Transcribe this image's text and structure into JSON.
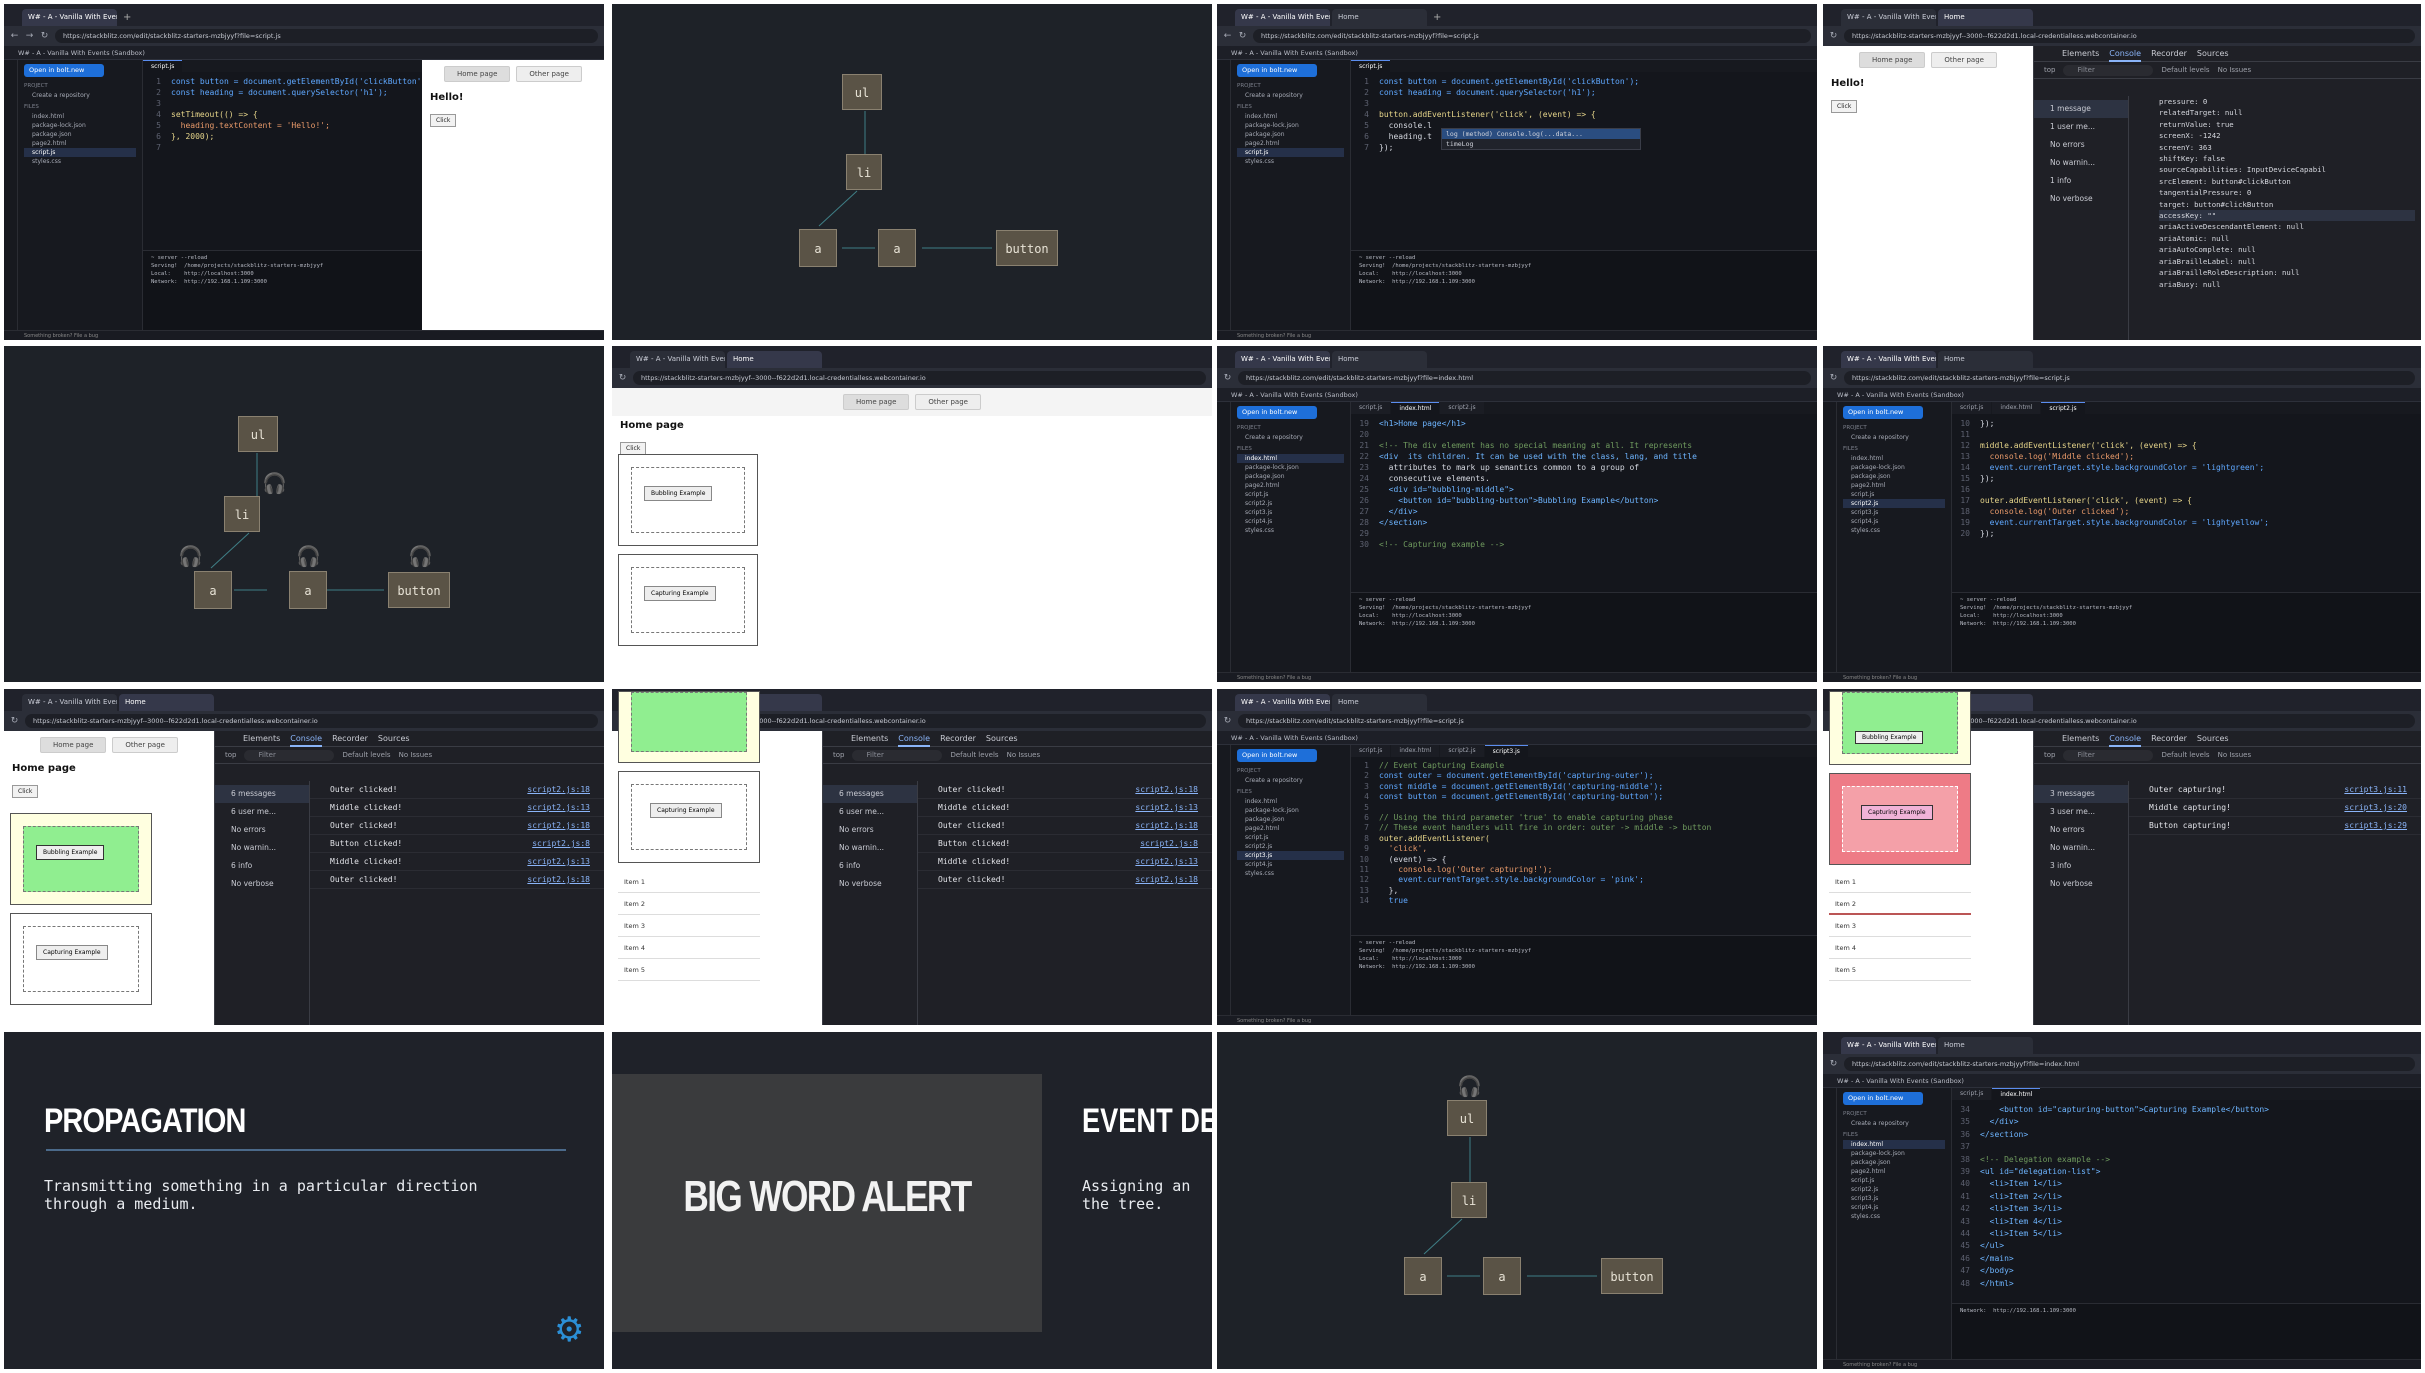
{
  "browser": {
    "tab_main": "W# - A - Vanilla With Events (...",
    "tab_home": "Home",
    "url_code": "https://stackblitz.com/edit/stackblitz-starters-mzbjyyf?file=script.js",
    "url_preview": "https://stackblitz-starters-mzbjyyf--3000--f622d2d1.local-credentialless.webcontainer.io",
    "url_index": "https://stackblitz.com/edit/stackblitz-starters-mzbjyyf?file=index.html",
    "bolt_title": "W# - A - Vanilla With Events (Sandbox)"
  },
  "ide": {
    "open_in": "Open in bolt.new",
    "project": "PROJECT",
    "create_repo": "Create a repository",
    "files_header": "FILES",
    "files": [
      "index.html",
      "package-lock.json",
      "package.json",
      "page2.html",
      "script.js",
      "styles.css"
    ],
    "files_ext": [
      "index.html",
      "package-lock.json",
      "package.json",
      "page2.html",
      "script.js",
      "script2.js",
      "script3.js",
      "script4.js",
      "styles.css"
    ],
    "terminal_lines": [
      "~ server --reload",
      "",
      "Serving!  /home/projects/stackblitz-starters-mzbjyyf",
      "",
      "Local:    http://localhost:3000",
      "Network:  http://192.168.1.109:3000"
    ],
    "status_text": "Something broken? File a bug"
  },
  "frames": {
    "f1_code": [
      "const button = document.getElementById('clickButton');",
      "const heading = document.querySelector('h1');",
      "",
      "setTimeout(() => {",
      "  heading.textContent = 'Hello!';",
      "}, 2000);",
      ""
    ],
    "f3_code": [
      "const button = document.getElementById('clickButton');",
      "const heading = document.querySelector('h1');",
      "",
      "button.addEventListener('click', (event) => {",
      "  console.l",
      "  heading.t",
      "});"
    ],
    "f3_autocomplete": [
      "log     (method) Console.log(...data...",
      "timeLog"
    ],
    "f7_code": [
      "<h1>Home page</h1>",
      "",
      "<!-- The div element has no special meaning at all. It represents",
      "<div  its children. It can be used with the class, lang, and title",
      "  attributes to mark up semantics common to a group of",
      "  consecutive elements.",
      "  <div id=\"bubbling-middle\">",
      "    <button id=\"bubbling-button\">Bubbling Example</button>",
      "  </div>",
      "</section>",
      "",
      "<!-- Capturing example -->"
    ],
    "f7_lines": [
      "19",
      "20",
      "21",
      "22",
      "23",
      "24",
      "25",
      "26",
      "27",
      "28",
      "29",
      "30",
      "31"
    ],
    "f8_code": [
      "});",
      "",
      "middle.addEventListener('click', (event) => {",
      "  console.log('Middle clicked');",
      "  event.currentTarget.style.backgroundColor = 'lightgreen';",
      "});",
      "",
      "outer.addEventListener('click', (event) => {",
      "  console.log('Outer clicked');",
      "  event.currentTarget.style.backgroundColor = 'lightyellow';",
      "});"
    ],
    "f8_lines": [
      "10",
      "11",
      "12",
      "13",
      "14",
      "15",
      "16",
      "17",
      "18",
      "19",
      "20",
      "21"
    ],
    "f11_code": [
      "// Event Capturing Example",
      "const outer = document.getElementById('capturing-outer');",
      "const middle = document.getElementById('capturing-middle');",
      "const button = document.getElementById('capturing-button');",
      "",
      "// Using the third parameter 'true' to enable capturing phase",
      "// These event handlers will fire in order: outer -> middle -> button",
      "outer.addEventListener(",
      "  'click',",
      "  (event) => {",
      "    console.log('Outer capturing!');",
      "    event.currentTarget.style.backgroundColor = 'pink';",
      "  },",
      "  true"
    ],
    "f16_code": [
      "    <button id=\"capturing-button\">Capturing Example</button>",
      "  </div>",
      "</section>",
      "",
      "<!-- Delegation example -->",
      "<ul id=\"delegation-list\">",
      "  <li>Item 1</li>",
      "  <li>Item 2</li>",
      "  <li>Item 3</li>",
      "  <li>Item 4</li>",
      "  <li>Item 5</li>",
      "</ul>",
      "</main>",
      "</body>",
      "</html>"
    ],
    "f16_lines": [
      "34",
      "35",
      "36",
      "37",
      "38",
      "39",
      "40",
      "41",
      "42",
      "43",
      "44",
      "45",
      "46",
      "47",
      "48"
    ]
  },
  "preview": {
    "home": "Home page",
    "other": "Other page",
    "hello": "Hello!",
    "click": "Click",
    "home_title": "Home page",
    "bubbling": "Bubbling Example",
    "capturing": "Capturing Example",
    "items": [
      "Item 1",
      "Item 2",
      "Item 3",
      "Item 4",
      "Item 5"
    ]
  },
  "devtools": {
    "tabs": [
      "Elements",
      "Console",
      "Recorder",
      "Sources"
    ],
    "top": "top",
    "filter": "Filter",
    "levels": "Default levels",
    "no_issues": "No Issues",
    "side_f4": [
      "1 message",
      "1 user me...",
      "No errors",
      "No warnin...",
      "1 info",
      "No verbose"
    ],
    "side_f9": [
      "6 messages",
      "6 user me...",
      "No errors",
      "No warnin...",
      "6 info",
      "No verbose"
    ],
    "side_f12": [
      "3 messages",
      "3 user me...",
      "No errors",
      "No warnin...",
      "3 info",
      "No verbose"
    ],
    "f4_props": [
      "pressure: 0",
      "relatedTarget: null",
      "returnValue: true",
      "screenX: -1242",
      "screenY: 363",
      "shiftKey: false",
      "sourceCapabilities: InputDeviceCapabil",
      "srcElement: button#clickButton",
      "tangentialPressure: 0",
      "target: button#clickButton",
      "accessKey: \"\"",
      "ariaActiveDescendantElement: null",
      "ariaAtomic: null",
      "ariaAutoComplete: null",
      "ariaBrailleLabel: null",
      "ariaBrailleRoleDescription: null",
      "ariaBusy: null"
    ],
    "f9_logs": [
      [
        "Outer clicked!",
        "script2.js:18"
      ],
      [
        "Middle clicked!",
        "script2.js:13"
      ],
      [
        "Outer clicked!",
        "script2.js:18"
      ],
      [
        "Button clicked!",
        "script2.js:8"
      ],
      [
        "Middle clicked!",
        "script2.js:13"
      ],
      [
        "Outer clicked!",
        "script2.js:18"
      ]
    ],
    "f12_logs": [
      [
        "Outer capturing!",
        "script3.js:11"
      ],
      [
        "Middle capturing!",
        "script3.js:20"
      ],
      [
        "Button capturing!",
        "script3.js:29"
      ]
    ]
  },
  "diagram": {
    "ul": "ul",
    "li": "li",
    "a": "a",
    "button": "button"
  },
  "slides": {
    "propagation_title": "PROPAGATION",
    "propagation_text": "Transmitting something in a particular direction\nthrough a medium.",
    "big_word": "BIG WORD ALERT",
    "delegation_title": "EVENT DEL",
    "delegation_text": "Assigning an\nthe tree."
  },
  "colors": {
    "accent": "#1e6fd9",
    "link": "#8ab4f8",
    "node": "#5a5346",
    "slide_line": "#4b6a8a",
    "capturing_pink": "#ee7b86",
    "bubbling_green": "#90ee90",
    "bubbling_yellow": "#ffffe0"
  }
}
